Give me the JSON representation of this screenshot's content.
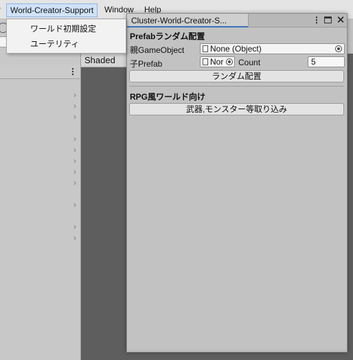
{
  "menubar": {
    "prev_item": "r",
    "active_item": "World-Creator-Support",
    "window_item": "Window",
    "help_item": "Help"
  },
  "dropdown": {
    "items": [
      "ワールド初期設定",
      "ユーテリティ"
    ]
  },
  "scene": {
    "shading_mode": "Shaded"
  },
  "left_panel": {
    "kebab": "⋮",
    "chevron": "›"
  },
  "window": {
    "tab_title": "Cluster-World-Creator-S...",
    "kebab": "⋮",
    "close": "✕",
    "section1": {
      "title": "Prefabランダム配置",
      "parent_label": "親GameObject",
      "parent_value": "None (Object)",
      "child_label": "子Prefab",
      "child_value": "Nor",
      "count_label": "Count",
      "count_value": "5",
      "button_label": "ランダム配置"
    },
    "section2": {
      "title": "RPG風ワールド向け",
      "button_label": "武器,モンスター等取り込み"
    }
  }
}
